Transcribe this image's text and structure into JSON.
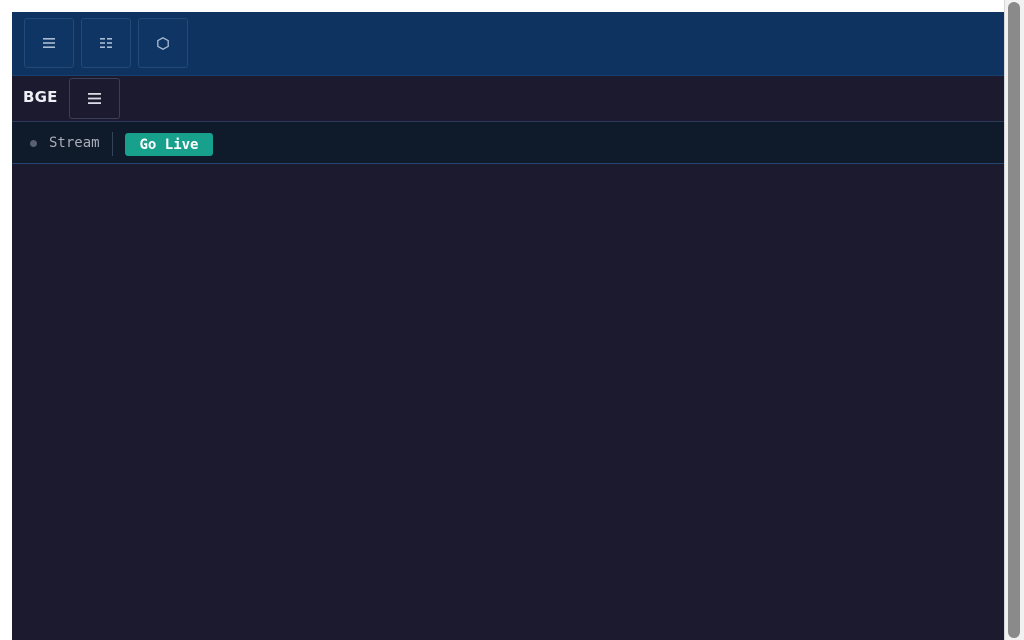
{
  "toolbar": {
    "buttons": [
      {
        "icon": "list-icon"
      },
      {
        "icon": "grid-icon"
      },
      {
        "icon": "hexagon-icon"
      }
    ]
  },
  "header": {
    "title": "BGE",
    "menu_icon": "hamburger-menu-icon"
  },
  "stream_bar": {
    "label": "Stream",
    "status": "offline",
    "go_live_label": "Go Live"
  },
  "colors": {
    "toolbar_bg": "#0e3361",
    "app_bg": "#1c1a2e",
    "stream_bar_bg": "#0f1a2a",
    "accent": "#17a08c",
    "status_offline": "#5a6070"
  }
}
